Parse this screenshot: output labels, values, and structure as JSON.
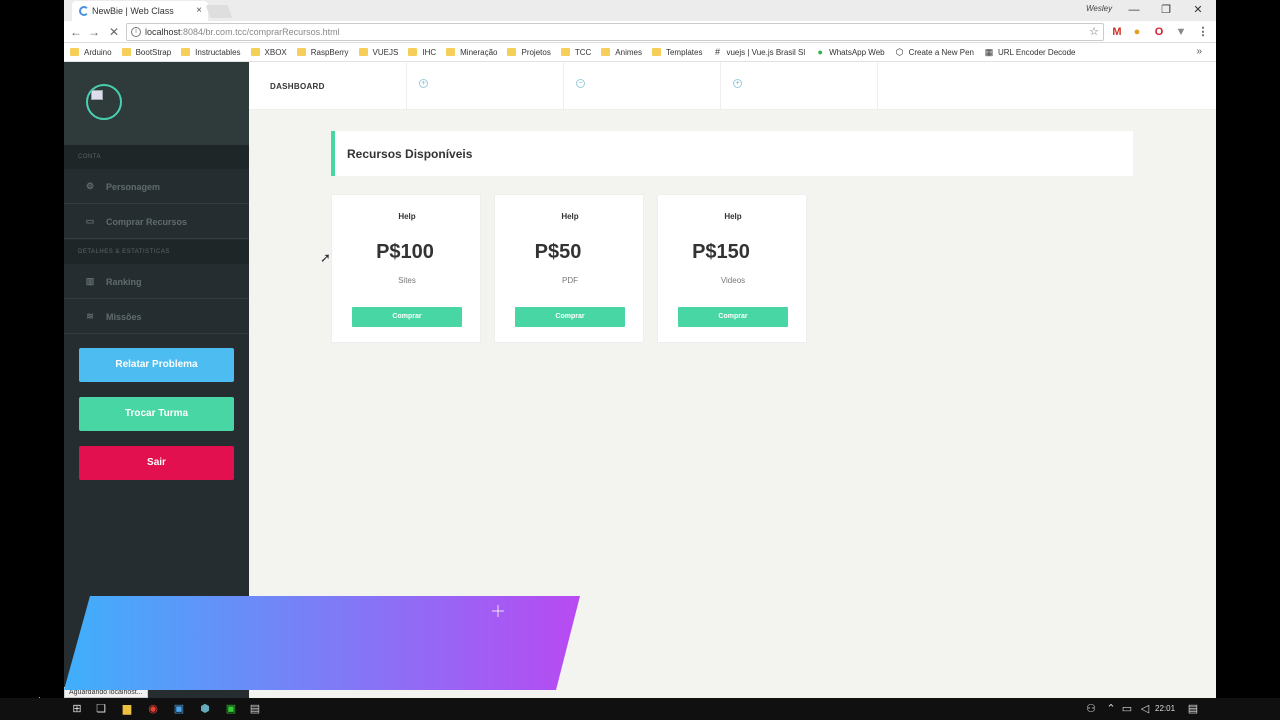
{
  "browser": {
    "tab_title": "NewBie | Web Class",
    "tab_close": "×",
    "window_user": "Wesley",
    "minimize": "—",
    "restore": "❐",
    "close": "✕",
    "back": "←",
    "forward": "→",
    "reload": "✕",
    "url_host": "localhost",
    "url_rest": ":8084/br.com.tcc/comprarRecursos.html",
    "star": "☆",
    "menu": "⋮",
    "bookmarks": [
      {
        "label": "Arduino",
        "icon": "folder-icon"
      },
      {
        "label": "BootStrap",
        "icon": "folder-icon"
      },
      {
        "label": "Instructables",
        "icon": "folder-icon"
      },
      {
        "label": "XBOX",
        "icon": "folder-icon"
      },
      {
        "label": "RaspBerry",
        "icon": "folder-icon"
      },
      {
        "label": "VUEJS",
        "icon": "folder-icon"
      },
      {
        "label": "IHC",
        "icon": "folder-icon"
      },
      {
        "label": "Mineração",
        "icon": "folder-icon"
      },
      {
        "label": "Projetos",
        "icon": "folder-icon"
      },
      {
        "label": "TCC",
        "icon": "folder-icon"
      },
      {
        "label": "Animes",
        "icon": "folder-icon"
      },
      {
        "label": "Templates",
        "icon": "folder-icon"
      },
      {
        "label": "vuejs | Vue.js Brasil Sl",
        "icon": "hash-icon"
      },
      {
        "label": "WhatsApp Web",
        "icon": "whatsapp-icon"
      },
      {
        "label": "Create a New Pen",
        "icon": "codepen-icon"
      },
      {
        "label": "URL Encoder Decode",
        "icon": "grid-icon"
      }
    ],
    "bookmarks_more": "»",
    "status_text": "Aguardando localhost..."
  },
  "sidebar": {
    "section_account": "CONTA",
    "section_stats": "DETALHES & ESTATISTICAS",
    "items": [
      {
        "label": "Personagem",
        "icon": "⚙"
      },
      {
        "label": "Comprar Recursos",
        "icon": "▭"
      },
      {
        "label": "Ranking",
        "icon": "▥"
      },
      {
        "label": "Missões",
        "icon": "≋"
      }
    ],
    "btn_report": "Relatar Problema",
    "btn_switch_class": "Trocar Turma",
    "btn_logout": "Sair"
  },
  "topbar": {
    "title": "DASHBOARD",
    "cell_icons": [
      "+",
      "−",
      "+"
    ]
  },
  "panel": {
    "title": "Recursos Disponíveis"
  },
  "cards": [
    {
      "category": "Help",
      "price": "P$100",
      "type": "Sites",
      "button": "Comprar"
    },
    {
      "category": "Help",
      "price": "P$50",
      "type": "PDF",
      "button": "Comprar"
    },
    {
      "category": "Help",
      "price": "P$150",
      "type": "Videos",
      "button": "Comprar"
    }
  ],
  "colors": {
    "accent_green": "#48d6a4",
    "accent_blue": "#4dbcf0",
    "accent_red": "#e2104e",
    "sidebar_bg": "#262d30",
    "gradient_start": "#3fb0fb",
    "gradient_end": "#b84af2"
  },
  "taskbar": {
    "clock": "22:01"
  }
}
